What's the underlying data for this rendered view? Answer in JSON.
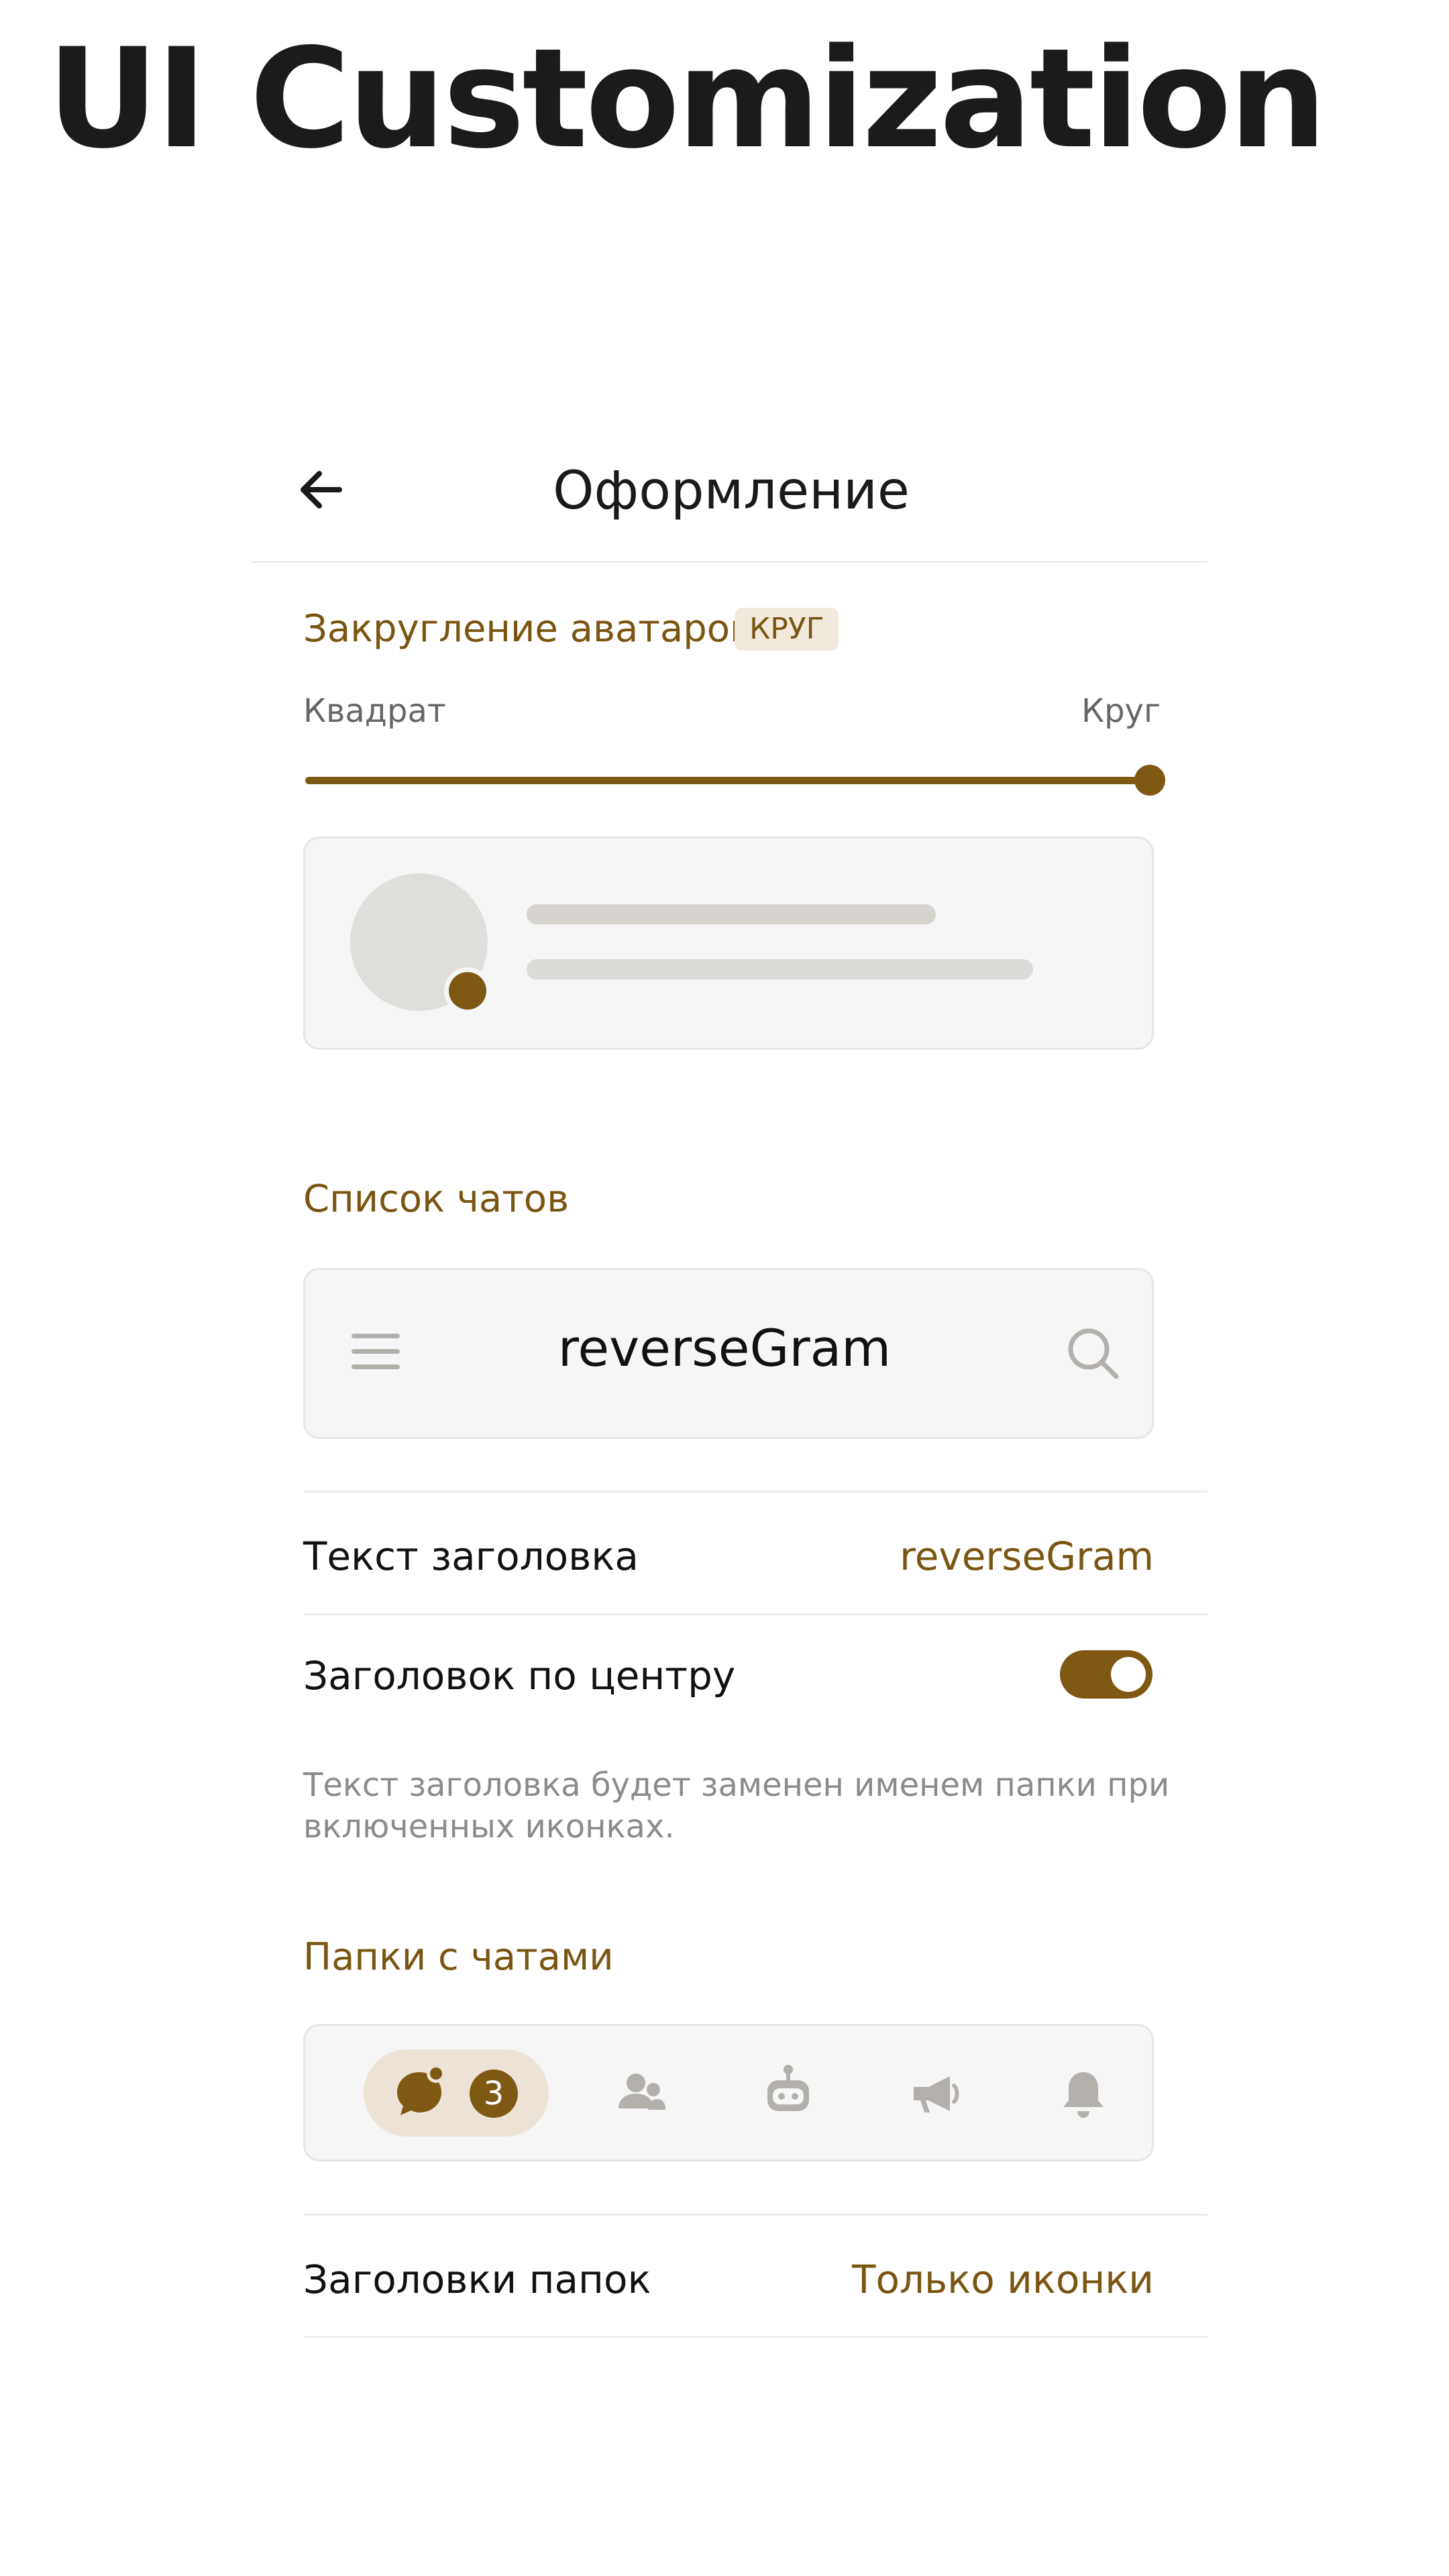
{
  "promo": {
    "title": "UI Customization"
  },
  "header": {
    "title": "Оформление"
  },
  "avatar_rounding": {
    "label": "Закругление аватарок",
    "badge": "КРУГ",
    "min_label": "Квадрат",
    "max_label": "Круг",
    "slider_value_percent": 100
  },
  "chat_list": {
    "label": "Список чатов",
    "preview_title": "reverseGram",
    "title_text_label": "Текст заголовка",
    "title_text_value": "reverseGram",
    "center_title_label": "Заголовок по центру",
    "center_title_enabled": true,
    "hint": "Текст заголовка будет заменен именем папки при включенных иконках."
  },
  "folders": {
    "label": "Папки с чатами",
    "selected_unread_count": "3",
    "icons": [
      "chat-bubble-icon",
      "users-icon",
      "bot-icon",
      "megaphone-icon",
      "bell-icon"
    ],
    "titles_label": "Заголовки папок",
    "titles_value": "Только иконки"
  },
  "colors": {
    "accent": "#7f5813",
    "accent_text": "#7a5512",
    "badge_bg": "#f1e9dc",
    "card_bg": "#f6f6f6",
    "icon_gray": "#b3b0ab"
  }
}
